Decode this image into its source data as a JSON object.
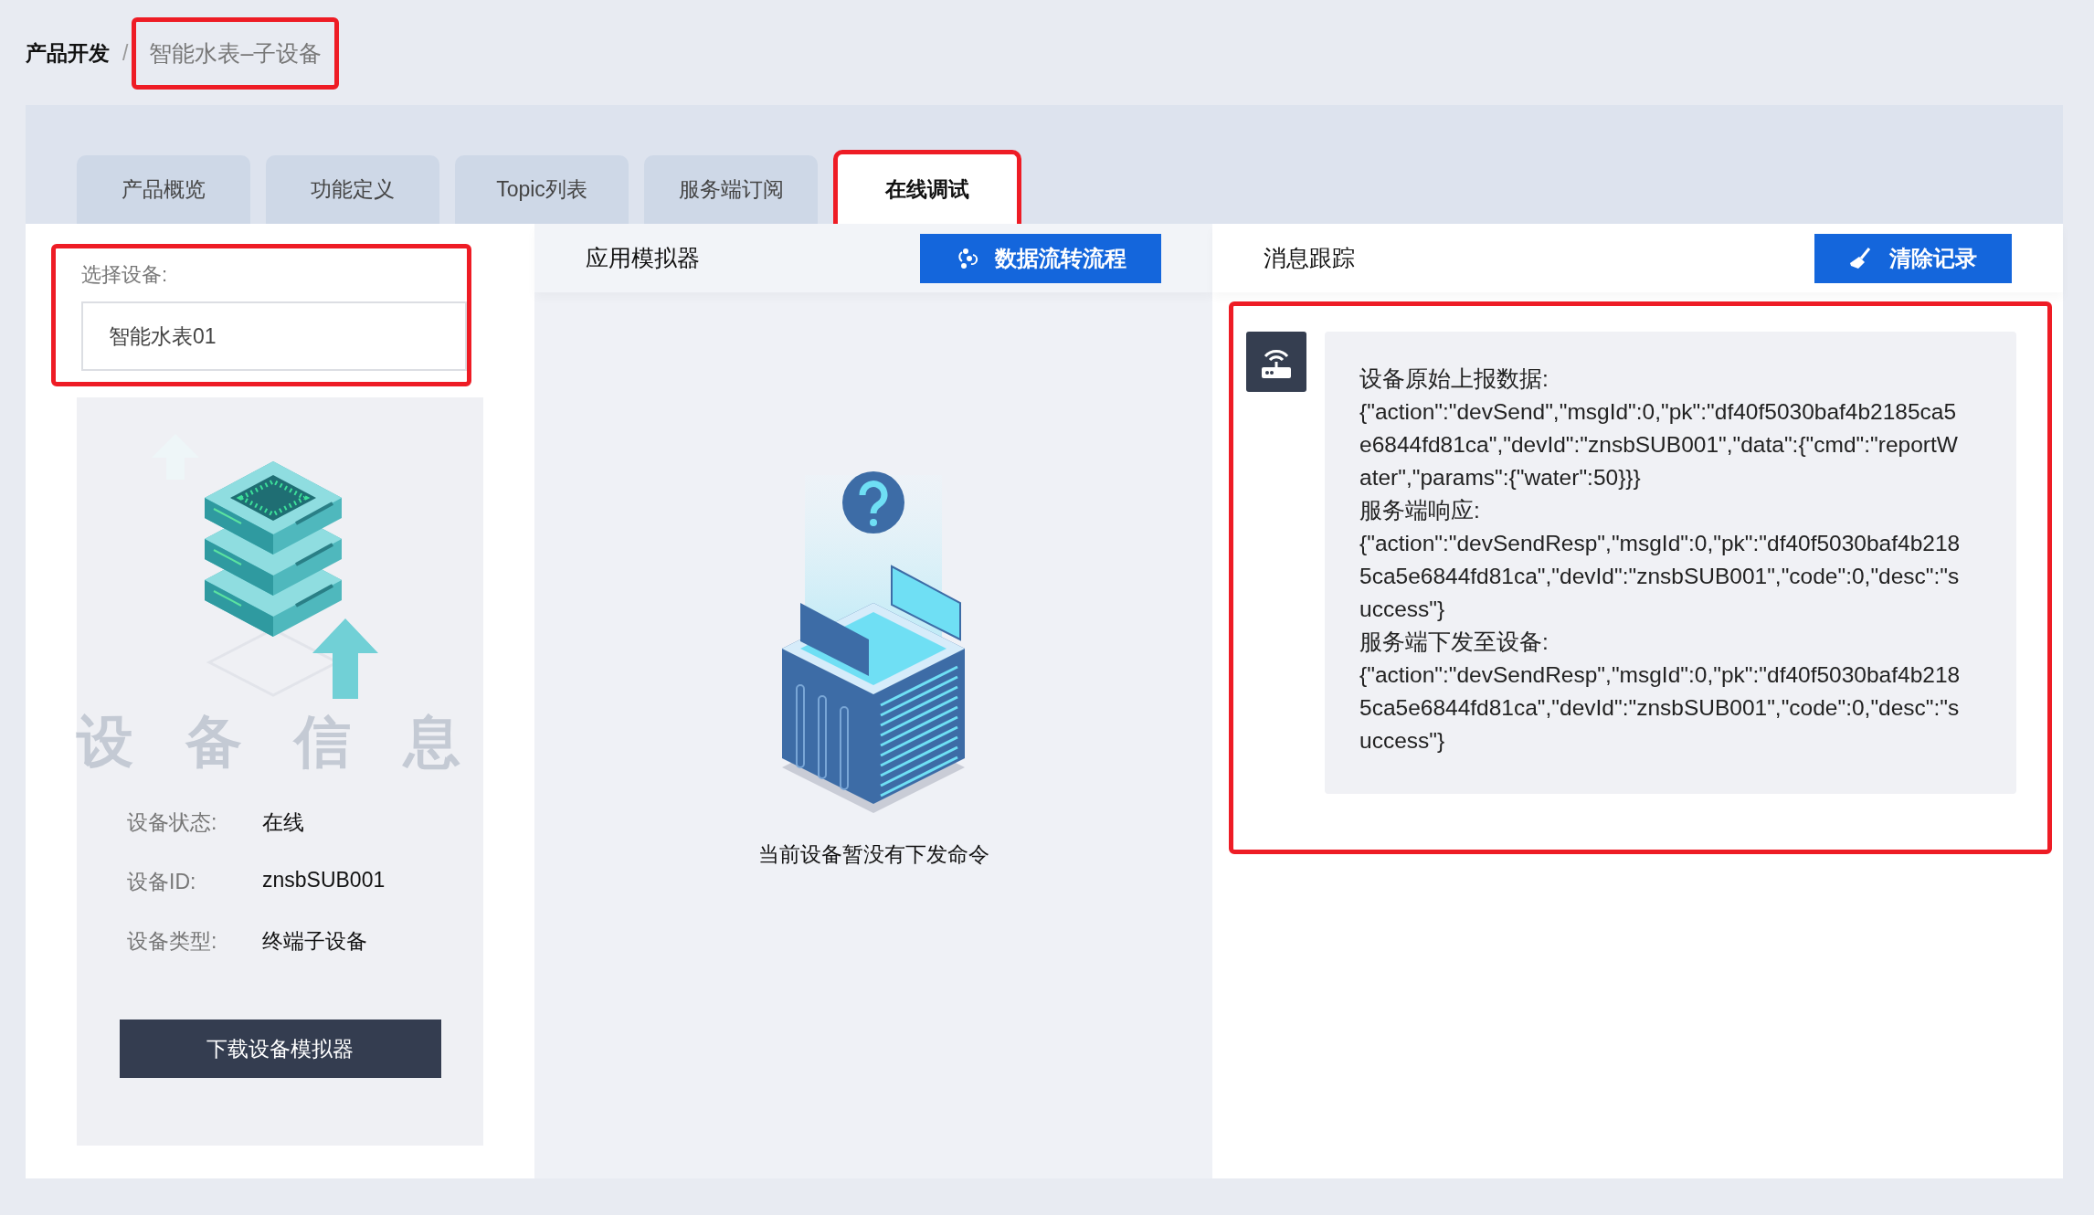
{
  "breadcrumb": {
    "root": "产品开发",
    "separator": "/",
    "current": "智能水表–子设备",
    "highlighted": true
  },
  "tabs": [
    {
      "label": "产品概览",
      "selected": false,
      "highlighted": false
    },
    {
      "label": "功能定义",
      "selected": false,
      "highlighted": false
    },
    {
      "label": "Topic列表",
      "selected": false,
      "highlighted": false
    },
    {
      "label": "服务端订阅",
      "selected": false,
      "highlighted": false
    },
    {
      "label": "在线调试",
      "selected": true,
      "highlighted": true
    }
  ],
  "device_panel": {
    "select_label": "选择设备:",
    "selected_device": "智能水表01",
    "highlighted": true,
    "background_text": "设 备 信 息",
    "info": [
      {
        "label": "设备状态:",
        "value": "在线"
      },
      {
        "label": "设备ID:",
        "value": "znsbSUB001"
      },
      {
        "label": "设备类型:",
        "value": "终端子设备"
      }
    ],
    "download_button": "下载设备模拟器"
  },
  "simulator": {
    "title": "应用模拟器",
    "button": "数据流转流程",
    "empty_text": "当前设备暂没有下发命令"
  },
  "trace": {
    "title": "消息跟踪",
    "button": "清除记录",
    "highlighted": true,
    "messages": [
      {
        "label": "设备原始上报数据:",
        "body": "{\"action\":\"devSend\",\"msgId\":0,\"pk\":\"df40f5030baf4b2185ca5e6844fd81ca\",\"devId\":\"znsbSUB001\",\"data\":{\"cmd\":\"reportWater\",\"params\":{\"water\":50}}}"
      },
      {
        "label": "服务端响应:",
        "body": "{\"action\":\"devSendResp\",\"msgId\":0,\"pk\":\"df40f5030baf4b2185ca5e6844fd81ca\",\"devId\":\"znsbSUB001\",\"code\":0,\"desc\":\"success\"}"
      },
      {
        "label": "服务端下发至设备:",
        "body": "{\"action\":\"devSendResp\",\"msgId\":0,\"pk\":\"df40f5030baf4b2185ca5e6844fd81ca\",\"devId\":\"znsbSUB001\",\"code\":0,\"desc\":\"success\"}"
      }
    ]
  }
}
